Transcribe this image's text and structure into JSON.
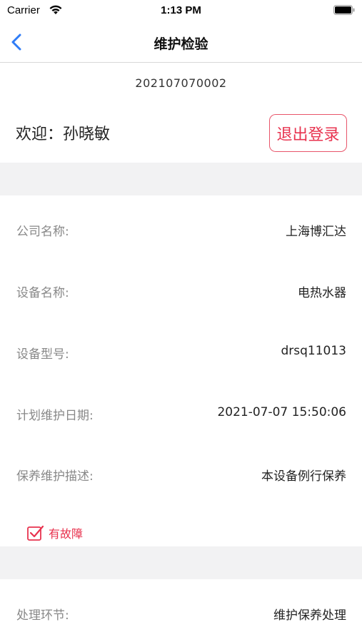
{
  "status_bar": {
    "carrier": "Carrier",
    "time": "1:13 PM",
    "icons": [
      "wifi-icon",
      "battery-icon"
    ]
  },
  "nav": {
    "title": "维护检验",
    "back_icon": "chevron-left-icon"
  },
  "order_number": "202107070002",
  "welcome": {
    "text": "欢迎：孙晓敏",
    "logout_label": "退出登录"
  },
  "fields": [
    {
      "label": "公司名称:",
      "value": "上海博汇达"
    },
    {
      "label": "设备名称:",
      "value": "电热水器"
    },
    {
      "label": "设备型号:",
      "value": "drsq11013"
    },
    {
      "label": "计划维护日期:",
      "value": "2021-07-07 15:50:06"
    },
    {
      "label": "保养维护描述:",
      "value": "本设备例行保养"
    }
  ],
  "fault": {
    "label": "有故障",
    "checked": true
  },
  "process": {
    "label": "处理环节:",
    "value": "维护保养处理"
  },
  "colors": {
    "accent_red": "#e8334f",
    "back_blue": "#2f7cf6",
    "section_gap": "#f2f2f3"
  }
}
